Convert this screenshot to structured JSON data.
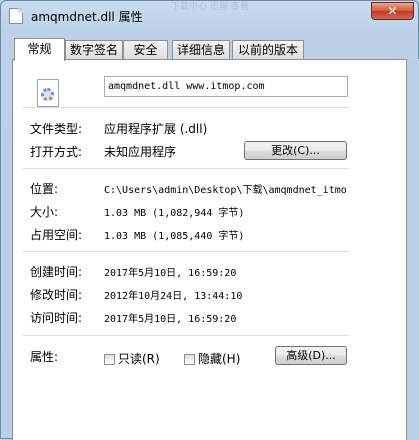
{
  "window": {
    "title": "amqmdnet.dll 属性",
    "background_title_hint": "下载中心 迅雷 查看",
    "close_label": "✕"
  },
  "tabs": [
    {
      "label": "常规",
      "active": true
    },
    {
      "label": "数字签名",
      "active": false
    },
    {
      "label": "安全",
      "active": false
    },
    {
      "label": "详细信息",
      "active": false
    },
    {
      "label": "以前的版本",
      "active": false
    }
  ],
  "general": {
    "file_name": "amqmdnet.dll www.itmop.com",
    "file_type_label": "文件类型:",
    "file_type_value": "应用程序扩展 (.dll)",
    "opens_with_label": "打开方式:",
    "opens_with_value": "未知应用程序",
    "change_button": "更改(C)...",
    "location_label": "位置:",
    "location_value": "C:\\Users\\admin\\Desktop\\下载\\amqmdnet_itmo",
    "size_label": "大小:",
    "size_value": "1.03 MB (1,082,944 字节)",
    "size_on_disk_label": "占用空间:",
    "size_on_disk_value": "1.03 MB (1,085,440 字节)",
    "created_label": "创建时间:",
    "created_value": "2017年5月10日, 16:59:20",
    "modified_label": "修改时间:",
    "modified_value": "2012年10月24日, 13:44:10",
    "accessed_label": "访问时间:",
    "accessed_value": "2017年5月10日, 16:59:20",
    "attributes_label": "属性:",
    "readonly_label": "只读(R)",
    "readonly_checked": false,
    "hidden_label": "隐藏(H)",
    "hidden_checked": false,
    "advanced_button": "高级(D)..."
  }
}
